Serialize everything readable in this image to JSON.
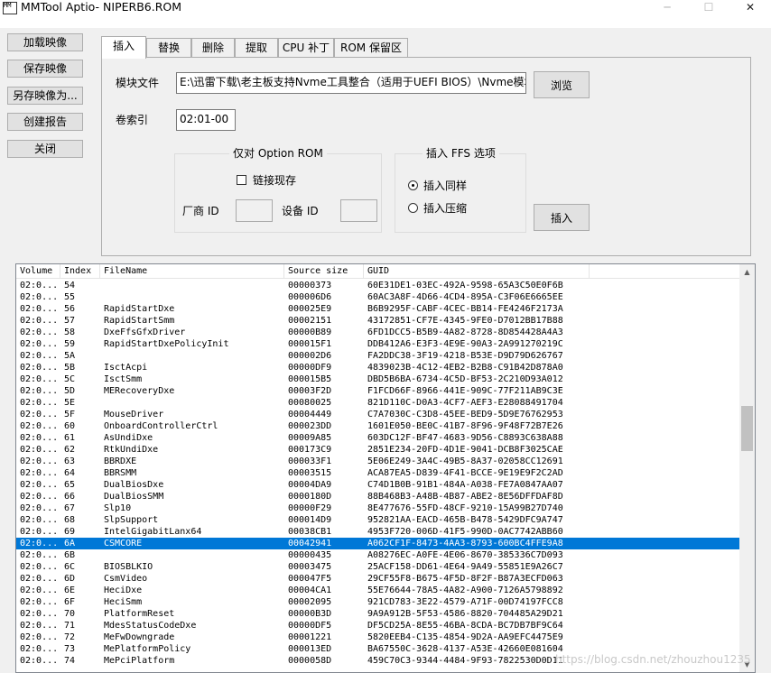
{
  "window": {
    "icon_text": "MM",
    "title": "MMTool Aptio- NIPERB6.ROM",
    "minimize": "─",
    "maximize": "☐",
    "close": "✕"
  },
  "left_buttons": {
    "load": "加载映像",
    "save": "保存映像",
    "save_as": "另存映像为...",
    "report": "创建报告",
    "close": "关闭"
  },
  "tabs": [
    "插入",
    "替换",
    "删除",
    "提取",
    "CPU 补丁",
    "ROM 保留区"
  ],
  "insert": {
    "module_file_label": "模块文件",
    "module_file_value": "E:\\迅雷下载\\老主板支持Nvme工具整合（适用于UEFI BIOS）\\Nvme模块\\",
    "browse": "浏览",
    "volume_label": "卷索引",
    "volume_value": "02:01-00",
    "option_rom_title": "仅对 Option ROM",
    "link_existing": "链接现存",
    "vendor_id": "厂商 ID",
    "device_id": "设备 ID",
    "ffs_title": "插入 FFS 选项",
    "insert_same": "插入同样",
    "insert_compress": "插入压缩",
    "insert_button": "插入"
  },
  "table": {
    "columns": [
      "Volume",
      "Index",
      "FileName",
      "Source size",
      "GUID"
    ],
    "rows": [
      [
        "02:0...",
        "54",
        "",
        "00000373",
        "60E31DE1-03EC-492A-9598-65A3C50E0F6B"
      ],
      [
        "02:0...",
        "55",
        "",
        "000006D6",
        "60AC3A8F-4D66-4CD4-895A-C3F06E6665EE"
      ],
      [
        "02:0...",
        "56",
        "RapidStartDxe",
        "000025E9",
        "B6B9295F-CABF-4CEC-BB14-FE4246F2173A"
      ],
      [
        "02:0...",
        "57",
        "RapidStartSmm",
        "00002151",
        "43172851-CF7E-4345-9FE0-D7012BB17B88"
      ],
      [
        "02:0...",
        "58",
        "DxeFfsGfxDriver",
        "00000B89",
        "6FD1DCC5-B5B9-4A82-8728-8D854428A4A3"
      ],
      [
        "02:0...",
        "59",
        "RapidStartDxePolicyInit",
        "000015F1",
        "DDB412A6-E3F3-4E9E-90A3-2A991270219C"
      ],
      [
        "02:0...",
        "5A",
        "",
        "000002D6",
        "FA2DDC38-3F19-4218-B53E-D9D79D626767"
      ],
      [
        "02:0...",
        "5B",
        "IsctAcpi",
        "00000DF9",
        "4839023B-4C12-4EB2-B2B8-C91B42D878A0"
      ],
      [
        "02:0...",
        "5C",
        "IsctSmm",
        "000015B5",
        "DBD5B6BA-6734-4C5D-BF53-2C210D93A012"
      ],
      [
        "02:0...",
        "5D",
        "MERecoveryDxe",
        "00003F2D",
        "F1FCD66F-8966-441E-909C-77F211AB9C3E"
      ],
      [
        "02:0...",
        "5E",
        "",
        "00080025",
        "821D110C-D0A3-4CF7-AEF3-E28088491704"
      ],
      [
        "02:0...",
        "5F",
        "MouseDriver",
        "00004449",
        "C7A7030C-C3D8-45EE-BED9-5D9E76762953"
      ],
      [
        "02:0...",
        "60",
        "OnboardControllerCtrl",
        "000023DD",
        "1601E050-BE0C-41B7-8F96-9F48F72B7E26"
      ],
      [
        "02:0...",
        "61",
        "AsUndiDxe",
        "00009A85",
        "603DC12F-BF47-4683-9D56-C8893C638A88"
      ],
      [
        "02:0...",
        "62",
        "RtkUndiDxe",
        "000173C9",
        "2851E234-20FD-4D1E-9041-DCB8F3025CAE"
      ],
      [
        "02:0...",
        "63",
        "BBRDXE",
        "000033F1",
        "5E06E249-3A4C-49B5-8A37-02058CC12691"
      ],
      [
        "02:0...",
        "64",
        "BBRSMM",
        "00003515",
        "ACA87EA5-D839-4F41-BCCE-9E19E9F2C2AD"
      ],
      [
        "02:0...",
        "65",
        "DualBiosDxe",
        "00004DA9",
        "C74D1B0B-91B1-484A-A038-FE7A0847AA07"
      ],
      [
        "02:0...",
        "66",
        "DualBiosSMM",
        "0000180D",
        "88B468B3-A48B-4B87-ABE2-8E56DFFDAF8D"
      ],
      [
        "02:0...",
        "67",
        "Slp10",
        "00000F29",
        "8E477676-55FD-48CF-9210-15A99B27D740"
      ],
      [
        "02:0...",
        "68",
        "SlpSupport",
        "000014D9",
        "952821AA-EACD-465B-B478-5429DFC9A747"
      ],
      [
        "02:0...",
        "69",
        "IntelGigabitLanx64",
        "00038CB1",
        "4953F720-006D-41F5-990D-0AC7742ABB60"
      ],
      [
        "02:0...",
        "6A",
        "CSMCORE",
        "00042941",
        "A062CF1F-8473-4AA3-8793-600BC4FFE9A8"
      ],
      [
        "02:0...",
        "6B",
        "",
        "00000435",
        "A08276EC-A0FE-4E06-8670-385336C7D093"
      ],
      [
        "02:0...",
        "6C",
        "BIOSBLKIO",
        "00003475",
        "25ACF158-DD61-4E64-9A49-55851E9A26C7"
      ],
      [
        "02:0...",
        "6D",
        "CsmVideo",
        "000047F5",
        "29CF55F8-B675-4F5D-8F2F-B87A3ECFD063"
      ],
      [
        "02:0...",
        "6E",
        "HeciDxe",
        "00004CA1",
        "55E76644-78A5-4A82-A900-7126A5798892"
      ],
      [
        "02:0...",
        "6F",
        "HeciSmm",
        "00002095",
        "921CD783-3E22-4579-A71F-00D74197FCC8"
      ],
      [
        "02:0...",
        "70",
        "PlatformReset",
        "00000B3D",
        "9A9A912B-5F53-4586-8820-704485A29D21"
      ],
      [
        "02:0...",
        "71",
        "MdesStatusCodeDxe",
        "00000DF5",
        "DF5CD25A-8E55-46BA-8CDA-BC7DB7BF9C64"
      ],
      [
        "02:0...",
        "72",
        "MeFwDowngrade",
        "00001221",
        "5820EEB4-C135-4854-9D2A-AA9EFC4475E9"
      ],
      [
        "02:0...",
        "73",
        "MePlatformPolicy",
        "000013ED",
        "BA67550C-3628-4137-A53E-42660E081604"
      ],
      [
        "02:0...",
        "74",
        "MePciPlatform",
        "0000058D",
        "459C70C3-9344-4484-9F93-7822530D0D11"
      ]
    ],
    "selected_index": 22
  },
  "colors": {
    "selection": "#0078d7",
    "window_bg": "#f0f0f0"
  },
  "watermark": "https://blog.csdn.net/zhouzhou1235"
}
